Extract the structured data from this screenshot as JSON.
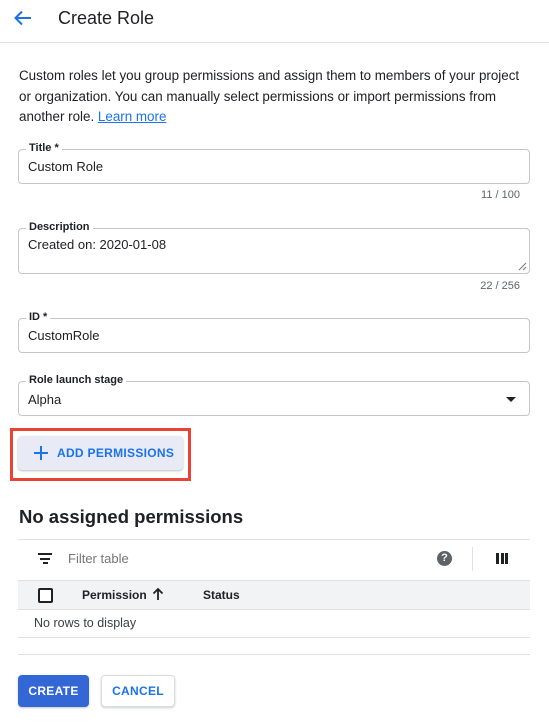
{
  "header": {
    "back_icon": "arrow-back-icon",
    "title": "Create Role"
  },
  "intro": {
    "text": "Custom roles let you group permissions and assign them to members of your project or organization. You can manually select permissions or import permissions from another role.",
    "link_label": "Learn more"
  },
  "form": {
    "title": {
      "label": "Title *",
      "value": "Custom Role",
      "counter": "11 / 100"
    },
    "description": {
      "label": "Description",
      "value": "Created on: 2020-01-08",
      "counter": "22 / 256"
    },
    "id": {
      "label": "ID *",
      "value": "CustomRole"
    },
    "launch_stage": {
      "label": "Role launch stage",
      "selected": "Alpha"
    }
  },
  "add_permissions": {
    "label": "ADD PERMISSIONS",
    "icon": "plus-icon"
  },
  "permissions": {
    "title": "No assigned permissions",
    "filter_placeholder": "Filter table",
    "columns": [
      "Permission",
      "Status"
    ],
    "empty_text": "No rows to display",
    "icons": {
      "filter": "filter-icon",
      "help": "help-icon",
      "columns": "column-display-icon",
      "sort": "arrow-up-icon"
    }
  },
  "actions": {
    "create": "CREATE",
    "cancel": "CANCEL"
  },
  "colors": {
    "accent": "#1a73e8",
    "primary_button": "#3367d6",
    "highlight_outline": "#ea4335"
  }
}
